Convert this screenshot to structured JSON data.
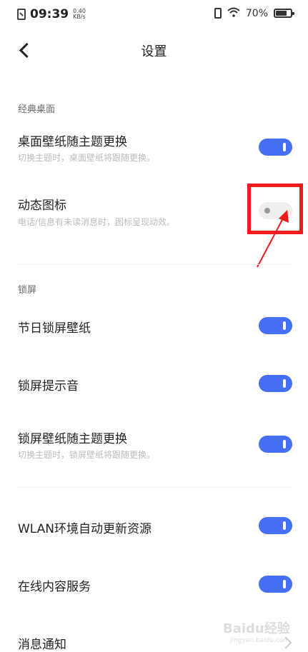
{
  "status_bar": {
    "time": "09:39",
    "net_speed_value": "0.40",
    "net_speed_unit": "KB/s",
    "battery_percent": "70%",
    "battery_level": 0.7,
    "icons": [
      "sim-icon",
      "vibrate-icon",
      "wifi-icon",
      "battery-icon"
    ]
  },
  "header": {
    "title": "设置",
    "back_icon": "chevron-left-icon"
  },
  "sections": [
    {
      "label": "经典桌面",
      "items": [
        {
          "title": "桌面壁纸随主题更换",
          "subtitle": "切换主题时，桌面壁纸将跟随更换。",
          "enabled": true
        },
        {
          "title": "动态图标",
          "subtitle": "电话/信息有未读消息时，图标呈现动效。",
          "enabled": false
        }
      ]
    },
    {
      "label": "锁屏",
      "items": [
        {
          "title": "节日锁屏壁纸",
          "enabled": true
        },
        {
          "title": "锁屏提示音",
          "enabled": true
        },
        {
          "title": "锁屏壁纸随主题更换",
          "subtitle": "切换主题时，锁屏壁纸将跟随更换。",
          "enabled": true
        }
      ]
    },
    {
      "label": "",
      "items": [
        {
          "title": "WLAN环境自动更新资源",
          "enabled": true
        },
        {
          "title": "在线内容服务",
          "enabled": true
        },
        {
          "title": "消息通知"
        }
      ]
    }
  ],
  "watermark": {
    "text": "Baidu经验",
    "sub": "jingyan.baidu.com"
  },
  "colors": {
    "toggle_on": "#456ff7",
    "toggle_off": "#eeeeee",
    "highlight": "#ee1c1c",
    "arrow": "#ee1c1c"
  }
}
